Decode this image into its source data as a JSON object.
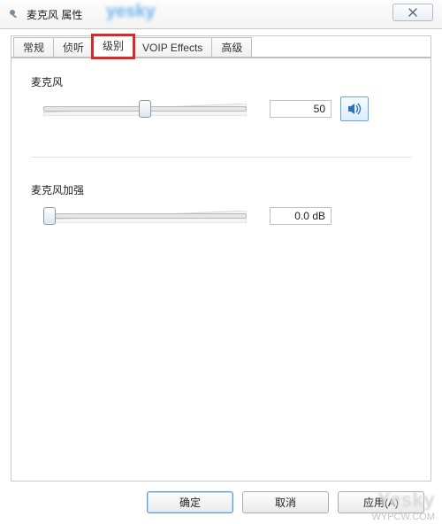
{
  "window": {
    "title": "麦克风 属性"
  },
  "tabs": {
    "items": [
      {
        "label": "常规"
      },
      {
        "label": "侦听"
      },
      {
        "label": "级别"
      },
      {
        "label": "VOIP Effects"
      },
      {
        "label": "高级"
      }
    ],
    "active_index": 2,
    "highlight_index": 2
  },
  "level": {
    "mic": {
      "label": "麦克风",
      "value": "50",
      "slider_pct": 50,
      "mute_icon": "speaker"
    },
    "boost": {
      "label": "麦克风加强",
      "value": "0.0 dB",
      "slider_pct": 3
    }
  },
  "buttons": {
    "ok": "确定",
    "cancel": "取消",
    "apply": "应用(A)"
  },
  "watermark": {
    "top": "yesky",
    "bottom_logo": "Yesky",
    "bottom_text": "WYPCW.COM"
  }
}
